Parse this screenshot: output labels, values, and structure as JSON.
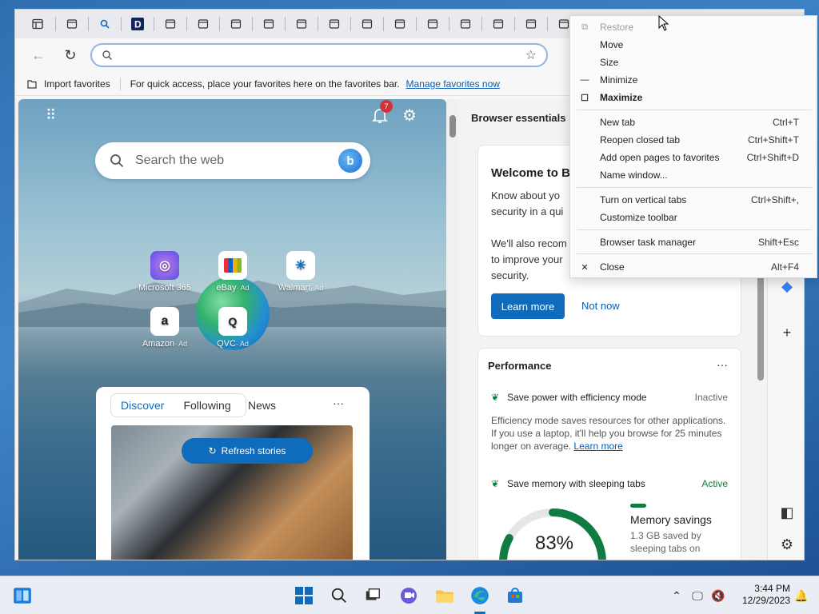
{
  "addressbar": {
    "placeholder": ""
  },
  "favorites_bar": {
    "import_label": "Import favorites",
    "hint": "For quick access, place your favorites here on the favorites bar.",
    "manage_link": "Manage favorites now"
  },
  "ntp": {
    "search_placeholder": "Search the web",
    "notification_count": "7",
    "tiles": [
      {
        "label": "Microsoft 365",
        "ad": ""
      },
      {
        "label": "eBay",
        "ad": "· Ad"
      },
      {
        "label": "Walmart",
        "ad": "· Ad"
      },
      {
        "label": "Amazon",
        "ad": "· Ad"
      },
      {
        "label": "QVC",
        "ad": "· Ad"
      }
    ],
    "feed": {
      "tabs": [
        "Discover",
        "Following"
      ],
      "news": "News",
      "more": "···",
      "refresh": "Refresh stories"
    }
  },
  "pane": {
    "title": "Browser essentials",
    "welcome": {
      "heading": "Welcome to B",
      "line1": "Know about yo",
      "line2": "security in a qui",
      "line3": "We'll also recom",
      "line4": "to improve your",
      "line5": "security.",
      "learn": "Learn more",
      "not_now": "Not now"
    },
    "performance": {
      "title": "Performance",
      "more": "···",
      "efficiency_label": "Save power with efficiency mode",
      "efficiency_status": "Inactive",
      "efficiency_desc": "Efficiency mode saves resources for other applications. If you use a laptop, it'll help you browse for 25 minutes longer on average.",
      "efficiency_link": "Learn more",
      "sleeping_label": "Save memory with sleeping tabs",
      "sleeping_status": "Active",
      "memory_percent": "83%",
      "memory_fraction": 0.83,
      "memory_title": "Memory savings",
      "memory_desc": "1.3 GB saved by sleeping tabs on"
    }
  },
  "context_menu": {
    "items": [
      {
        "label": "Restore",
        "shortcut": "",
        "glyph": "⧉",
        "state": "disabled"
      },
      {
        "label": "Move",
        "shortcut": "",
        "glyph": "",
        "state": "normal"
      },
      {
        "label": "Size",
        "shortcut": "",
        "glyph": "",
        "state": "normal"
      },
      {
        "label": "Minimize",
        "shortcut": "",
        "glyph": "—",
        "state": "normal"
      },
      {
        "label": "Maximize",
        "shortcut": "",
        "glyph": "☐",
        "state": "bold"
      },
      {
        "label": "New tab",
        "shortcut": "Ctrl+T",
        "glyph": "",
        "state": "normal"
      },
      {
        "label": "Reopen closed tab",
        "shortcut": "Ctrl+Shift+T",
        "glyph": "",
        "state": "normal"
      },
      {
        "label": "Add open pages to favorites",
        "shortcut": "Ctrl+Shift+D",
        "glyph": "",
        "state": "normal"
      },
      {
        "label": "Name window...",
        "shortcut": "",
        "glyph": "",
        "state": "normal"
      },
      {
        "label": "Turn on vertical tabs",
        "shortcut": "Ctrl+Shift+,",
        "glyph": "",
        "state": "normal"
      },
      {
        "label": "Customize toolbar",
        "shortcut": "",
        "glyph": "",
        "state": "normal"
      },
      {
        "label": "Browser task manager",
        "shortcut": "Shift+Esc",
        "glyph": "",
        "state": "normal"
      },
      {
        "label": "Close",
        "shortcut": "Alt+F4",
        "glyph": "✕",
        "state": "normal"
      }
    ]
  },
  "taskbar": {
    "time": "3:44 PM",
    "date": "12/29/2023"
  },
  "colors": {
    "accent": "#0f6cbd",
    "green": "#107c41"
  }
}
